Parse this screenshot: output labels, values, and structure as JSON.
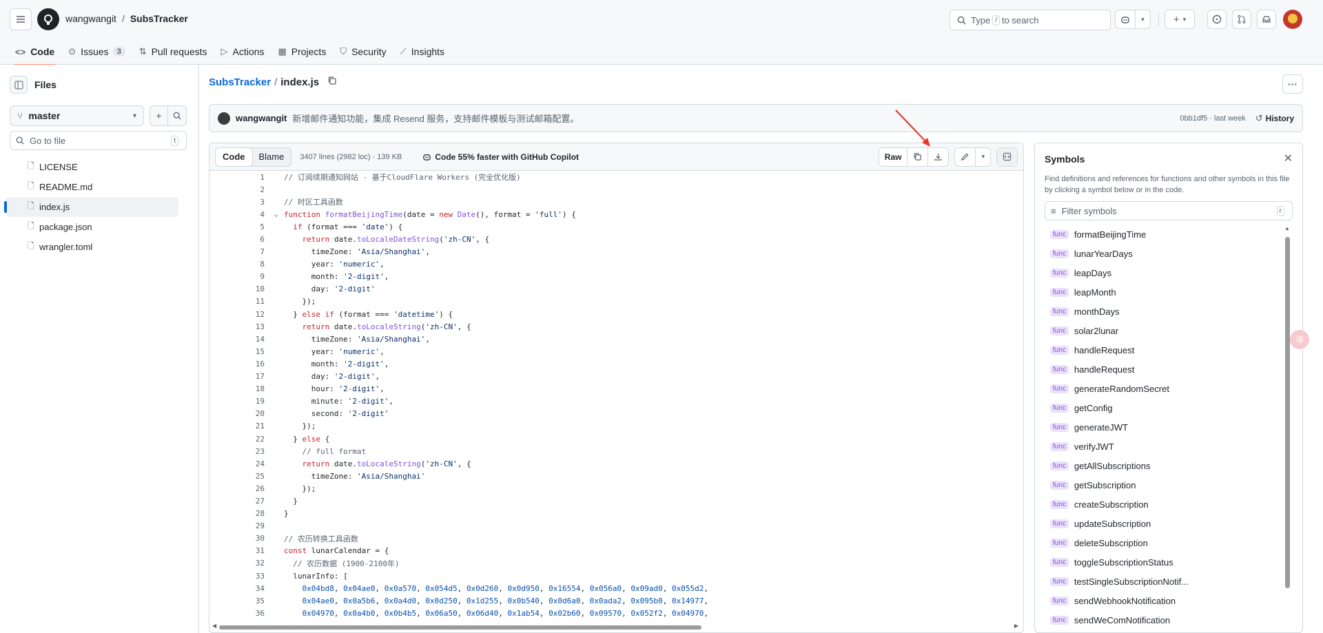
{
  "header": {
    "owner": "wangwangit",
    "repo": "SubsTracker",
    "search_text_before": "Type",
    "search_key": "/",
    "search_text_after": "to search"
  },
  "nav": {
    "tabs": [
      {
        "label": "Code",
        "icon": "code-icon"
      },
      {
        "label": "Issues",
        "icon": "issue-icon",
        "count": "3"
      },
      {
        "label": "Pull requests",
        "icon": "pr-icon"
      },
      {
        "label": "Actions",
        "icon": "play-icon"
      },
      {
        "label": "Projects",
        "icon": "table-icon"
      },
      {
        "label": "Security",
        "icon": "shield-icon"
      },
      {
        "label": "Insights",
        "icon": "graph-icon"
      }
    ]
  },
  "sidebar": {
    "title": "Files",
    "branch": "master",
    "goto_placeholder": "Go to file",
    "goto_key": "t",
    "files": [
      "LICENSE",
      "README.md",
      "index.js",
      "package.json",
      "wrangler.toml"
    ]
  },
  "file": {
    "repo": "SubsTracker",
    "name": "index.js"
  },
  "commit": {
    "author": "wangwangit",
    "message": "新增邮件通知功能，集成 Resend 服务，支持邮件模板与测试邮箱配置。",
    "meta": "0bb1df5 · last week",
    "history": "History"
  },
  "codebar": {
    "code_tab": "Code",
    "blame_tab": "Blame",
    "stats": "3407 lines (2982 loc) · 139 KB",
    "copilot": "Code 55% faster with GitHub Copilot",
    "raw": "Raw"
  },
  "code_lines": [
    "// 订阅续期通知网站 - 基于CloudFlare Workers (完全优化版)",
    "",
    "// 时区工具函数",
    "function formatBeijingTime(date = new Date(), format = 'full') {",
    "  if (format === 'date') {",
    "    return date.toLocaleDateString('zh-CN', {",
    "      timeZone: 'Asia/Shanghai',",
    "      year: 'numeric',",
    "      month: '2-digit',",
    "      day: '2-digit'",
    "    });",
    "  } else if (format === 'datetime') {",
    "    return date.toLocaleString('zh-CN', {",
    "      timeZone: 'Asia/Shanghai',",
    "      year: 'numeric',",
    "      month: '2-digit',",
    "      day: '2-digit',",
    "      hour: '2-digit',",
    "      minute: '2-digit',",
    "      second: '2-digit'",
    "    });",
    "  } else {",
    "    // full format",
    "    return date.toLocaleString('zh-CN', {",
    "      timeZone: 'Asia/Shanghai'",
    "    });",
    "  }",
    "}",
    "",
    "// 农历转换工具函数",
    "const lunarCalendar = {",
    "  // 农历数据 (1900-2100年)",
    "  lunarInfo: [",
    "    0x04bd8, 0x04ae0, 0x0a570, 0x054d5, 0x0d260, 0x0d950, 0x16554, 0x056a0, 0x09ad0, 0x055d2,",
    "    0x04ae0, 0x0a5b6, 0x0a4d0, 0x0d250, 0x1d255, 0x0b540, 0x0d6a0, 0x0ada2, 0x095b0, 0x14977,",
    "    0x04970, 0x0a4b0, 0x0b4b5, 0x06a50, 0x06d40, 0x1ab54, 0x02b60, 0x09570, 0x052f2, 0x04970,"
  ],
  "symbols": {
    "title": "Symbols",
    "description": "Find definitions and references for functions and other symbols in this file by clicking a symbol below or in the code.",
    "filter_placeholder": "Filter symbols",
    "kind": "func",
    "items": [
      "formatBeijingTime",
      "lunarYearDays",
      "leapDays",
      "leapMonth",
      "monthDays",
      "solar2lunar",
      "handleRequest",
      "handleRequest",
      "generateRandomSecret",
      "getConfig",
      "generateJWT",
      "verifyJWT",
      "getAllSubscriptions",
      "getSubscription",
      "createSubscription",
      "updateSubscription",
      "deleteSubscription",
      "toggleSubscriptionStatus",
      "testSingleSubscriptionNotif...",
      "sendWebhookNotification",
      "sendWeComNotification"
    ]
  }
}
